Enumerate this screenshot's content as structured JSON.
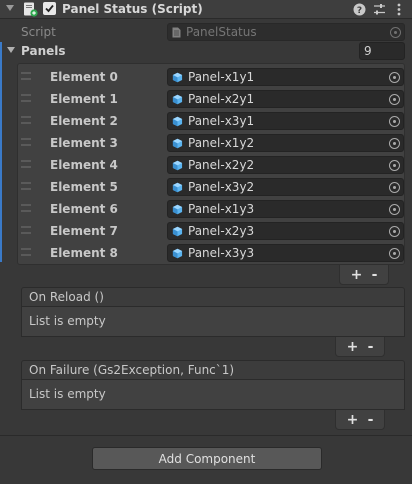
{
  "component": {
    "title": "Panel Status (Script)",
    "enabled": true
  },
  "script_field": {
    "label": "Script",
    "value": "PanelStatus"
  },
  "panels": {
    "label": "Panels",
    "size": "9",
    "elements": [
      {
        "label": "Element 0",
        "value": "Panel-x1y1"
      },
      {
        "label": "Element 1",
        "value": "Panel-x2y1"
      },
      {
        "label": "Element 2",
        "value": "Panel-x3y1"
      },
      {
        "label": "Element 3",
        "value": "Panel-x1y2"
      },
      {
        "label": "Element 4",
        "value": "Panel-x2y2"
      },
      {
        "label": "Element 5",
        "value": "Panel-x3y2"
      },
      {
        "label": "Element 6",
        "value": "Panel-x1y3"
      },
      {
        "label": "Element 7",
        "value": "Panel-x2y3"
      },
      {
        "label": "Element 8",
        "value": "Panel-x3y3"
      }
    ],
    "add_label": "+",
    "remove_label": "-"
  },
  "events": [
    {
      "header": "On Reload ()",
      "body": "List is empty",
      "add_label": "+",
      "remove_label": "-"
    },
    {
      "header": "On Failure (Gs2Exception, Func`1)",
      "body": "List is empty",
      "add_label": "+",
      "remove_label": "-"
    }
  ],
  "add_component_label": "Add Component",
  "colors": {
    "background": "#383838",
    "field": "#2a2a2a",
    "selection_bar": "#3a7ac8",
    "cube_icon": "#5bb4f0"
  },
  "icons": {
    "fold": "triangle-down-icon",
    "script": "script-icon",
    "help": "help-icon",
    "presets": "sliders-icon",
    "menu": "kebab-menu-icon",
    "object_picker": "target-icon",
    "prefab": "cube-icon"
  }
}
